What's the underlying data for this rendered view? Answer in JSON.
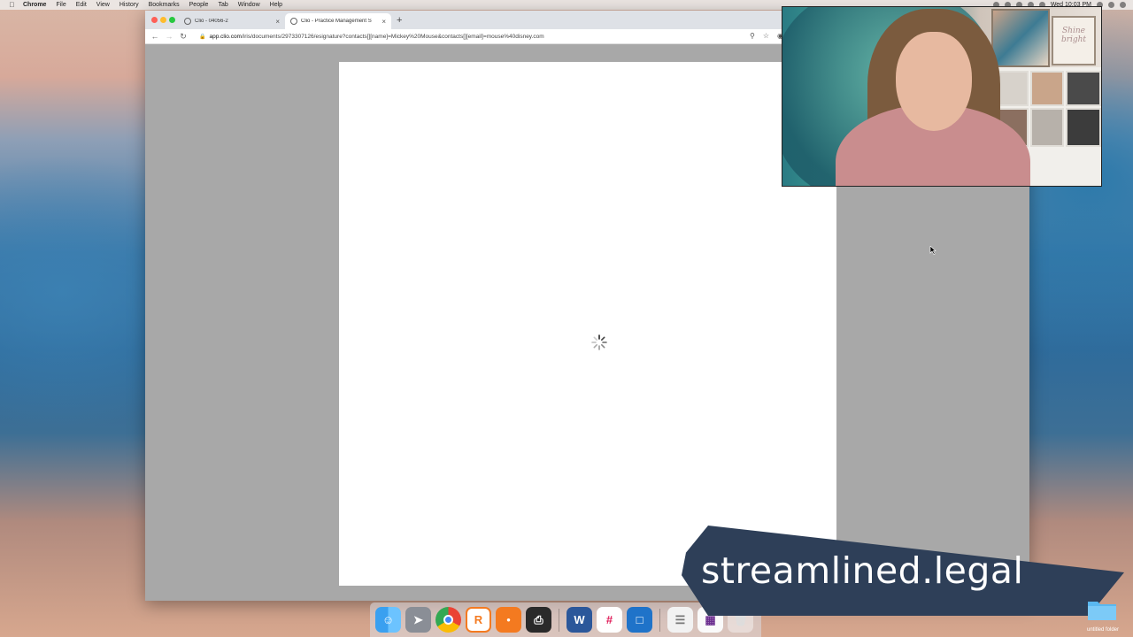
{
  "menubar": {
    "app": "Chrome",
    "items": [
      "File",
      "Edit",
      "View",
      "History",
      "Bookmarks",
      "People",
      "Tab",
      "Window",
      "Help"
    ],
    "clock": "Wed 10:03 PM"
  },
  "browser": {
    "tabs": [
      {
        "label": "Clio - 04056-2"
      },
      {
        "label": "Clio - Practice Management S"
      }
    ],
    "url_host": "app.clio.com",
    "url_path": "/iris/documents/2973307126/esignature?contacts[][name]=Mickey%20Mouse&contacts[][email]=mouse%40disney.com"
  },
  "webcam": {
    "sign_text": "Shine bright"
  },
  "banner": {
    "text": "streamlined.legal"
  },
  "desktop": {
    "folder_label": "untitled folder"
  },
  "dock": {
    "apps": [
      "finder",
      "launchpad",
      "chrome",
      "ringcentral",
      "zoom",
      "printer",
      "word",
      "slack",
      "keynote-live",
      "preview",
      "screenshot",
      "trash"
    ]
  },
  "colors": {
    "banner_bg": "#2e3f58",
    "window_bg": "#a8a8a8",
    "tabstrip": "#dee1e6"
  }
}
